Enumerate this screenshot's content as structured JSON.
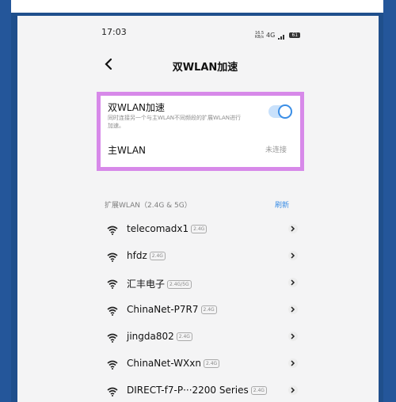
{
  "status_bar": {
    "time": "17:03",
    "net_speed": "16.5 KB/s",
    "signal": "4G",
    "battery": "61"
  },
  "header": {
    "title": "双WLAN加速"
  },
  "dual_wlan": {
    "label": "双WLAN加速",
    "description": "同时连接另一个与主WLAN不同频段的扩展WLAN进行加速。",
    "enabled": true,
    "main_label": "主WLAN",
    "main_status": "未连接"
  },
  "extended_wlan": {
    "section_title": "扩展WLAN（2.4G & 5G）",
    "refresh_label": "刷新",
    "networks": [
      {
        "ssid": "telecomadx1",
        "band": "2.4G"
      },
      {
        "ssid": "hfdz",
        "band": "2.4G"
      },
      {
        "ssid": "汇丰电子",
        "band": "2.4G/5G"
      },
      {
        "ssid": "ChinaNet-P7R7",
        "band": "2.4G"
      },
      {
        "ssid": "jingda802",
        "band": "2.4G"
      },
      {
        "ssid": "ChinaNet-WXxn",
        "band": "2.4G"
      },
      {
        "ssid": "DIRECT-f7-P···2200 Series",
        "band": "2.4G"
      }
    ]
  },
  "colors": {
    "accent": "#3b8ee6",
    "highlight_border": "#d789e9",
    "frame": "#24569a"
  }
}
